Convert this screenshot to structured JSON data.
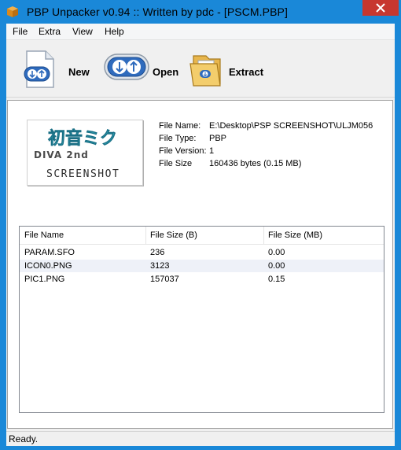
{
  "window": {
    "title": "PBP Unpacker v0.94 :: Written by pdc - [PSCM.PBP]"
  },
  "menu": {
    "items": [
      "File",
      "Extra",
      "View",
      "Help"
    ]
  },
  "toolbar": {
    "new_label": "New",
    "open_label": "Open",
    "extract_label": "Extract"
  },
  "fileinfo": {
    "name_label": "File Name:",
    "name_value": "E:\\Desktop\\PSP SCREENSHOT\\ULJM056",
    "type_label": "File Type:",
    "type_value": "PBP",
    "version_label": "File Version:",
    "version_value": "1",
    "size_label": "File Size",
    "size_value": "160436 bytes (0.15 MB)"
  },
  "logo": {
    "title_text": "初音ミク",
    "subtitle_text": "DIVA 2nd",
    "caption": "SCREENSHOT"
  },
  "list": {
    "columns": [
      "File Name",
      "File Size (B)",
      "File Size (MB)"
    ],
    "rows": [
      [
        "PARAM.SFO",
        "236",
        "0.00"
      ],
      [
        "ICON0.PNG",
        "3123",
        "0.00"
      ],
      [
        "PIC1.PNG",
        "157037",
        "0.15"
      ]
    ]
  },
  "status": {
    "text": "Ready."
  },
  "colors": {
    "accent": "#1a88d8",
    "close": "#c7372f",
    "alt_row": "#eef1f8"
  }
}
